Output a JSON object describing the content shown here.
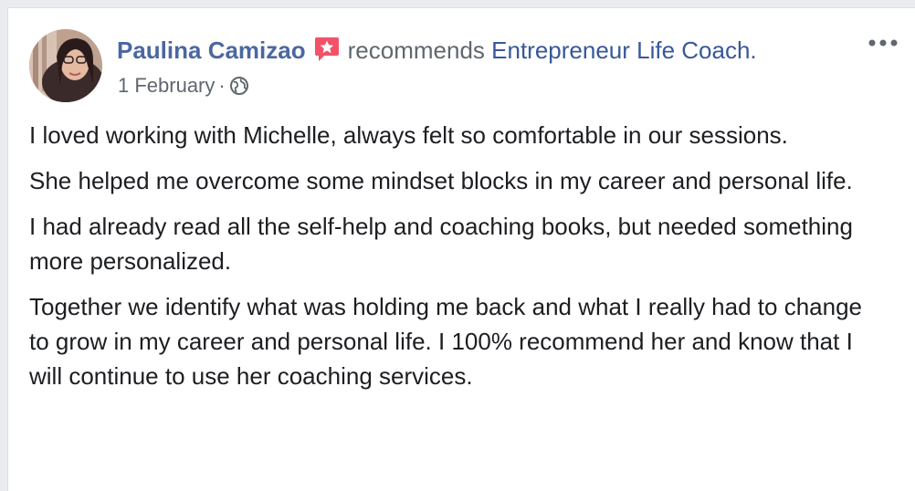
{
  "post": {
    "author": "Paulina Camizao",
    "verb": "recommends",
    "page_name": "Entrepreneur Life Coach.",
    "date": "1 February",
    "separator": "·",
    "privacy_icon": "globe-icon",
    "recommend_icon": "recommendation-star-icon",
    "more_icon": "more-options-icon"
  },
  "body": {
    "paragraphs": [
      "I loved working with Michelle, always felt so comfortable in our sessions.",
      "She helped me overcome some mindset blocks in my career and personal life.",
      "I had already read all the self-help and coaching books, but needed something more personalized.",
      "Together we identify what was holding me back and what I really had to change to grow in my career and personal life. I 100% recommend her and know that I will continue to use her coaching services."
    ]
  },
  "colors": {
    "author_name": "#4b67a1",
    "link": "#385898",
    "meta_text": "#606770",
    "body_text": "#1c1e21",
    "recommend_badge": "#f25268",
    "background": "#ffffff"
  }
}
